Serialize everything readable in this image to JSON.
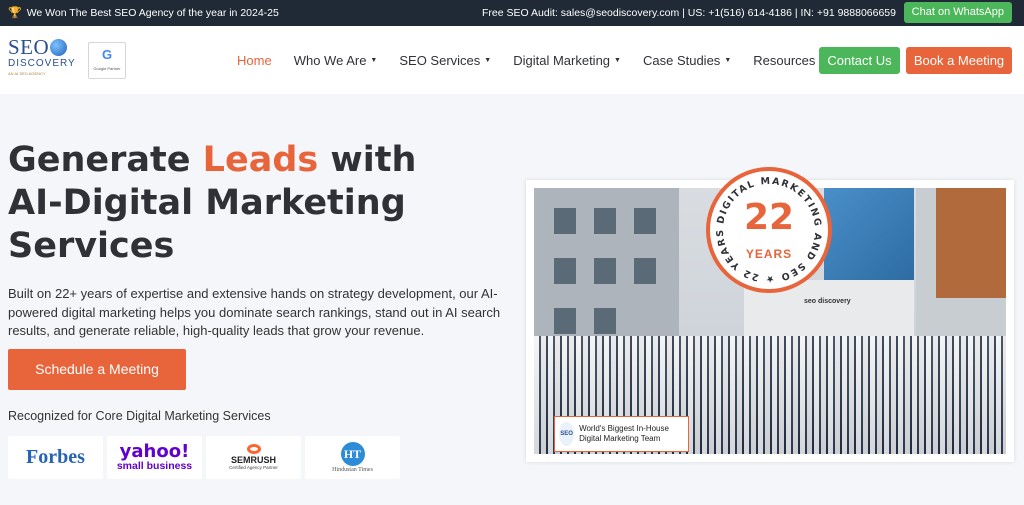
{
  "topbar": {
    "award_text": "We Won The Best SEO Agency of the year in 2024-25",
    "contact_text": "Free SEO Audit: sales@seodiscovery.com | US: +1(516) 614-4186 | IN: +91 9888066659",
    "whatsapp_label": "Chat on WhatsApp"
  },
  "header": {
    "logo_line1": "SEO",
    "logo_line2": "DISCOVERY",
    "logo_tagline": "AN AI SEO AGENCY",
    "google_partner_letter": "G",
    "google_partner_label": "Google Partner",
    "nav": [
      {
        "label": "Home",
        "active": true
      },
      {
        "label": "Who We Are",
        "dropdown": true
      },
      {
        "label": "SEO Services",
        "dropdown": true
      },
      {
        "label": "Digital Marketing",
        "dropdown": true
      },
      {
        "label": "Case Studies",
        "dropdown": true
      },
      {
        "label": "Resources",
        "dropdown": true
      }
    ],
    "contact_label": "Contact Us",
    "book_label": "Book a Meeting"
  },
  "hero": {
    "title_pre": "Generate ",
    "title_accent": "Leads",
    "title_post": " with AI-Digital Marketing Services",
    "description": "Built on 22+ years of expertise and extensive hands on strategy development, our AI-powered digital marketing helps you dominate search rankings, stand out in AI search results, and generate reliable, high-quality leads that grow your revenue.",
    "cta_label": "Schedule a Meeting",
    "recognized_label": "Recognized for Core Digital Marketing Services",
    "recognition_logos": [
      {
        "name": "Forbes",
        "text": "Forbes"
      },
      {
        "name": "yahoo",
        "text": "yahoo!",
        "sub": "small business"
      },
      {
        "name": "semrush",
        "text": "SEMRUSH",
        "sub": "Certified Agency Partner"
      },
      {
        "name": "hindustan-times",
        "text": "HT",
        "sub": "Hindustan Times"
      }
    ]
  },
  "photo": {
    "building_sign": "seo discovery",
    "team_card_logo": "SEO",
    "team_card_text": "World's Biggest In-House Digital Marketing Team"
  },
  "badge": {
    "ring_text": "DIGITAL MARKETING AND SEO ★ 22 YEARS ★",
    "number": "22",
    "label": "YEARS"
  },
  "colors": {
    "accent": "#e8643a",
    "green": "#4cb65a",
    "topbar_bg": "#1f2a36"
  }
}
